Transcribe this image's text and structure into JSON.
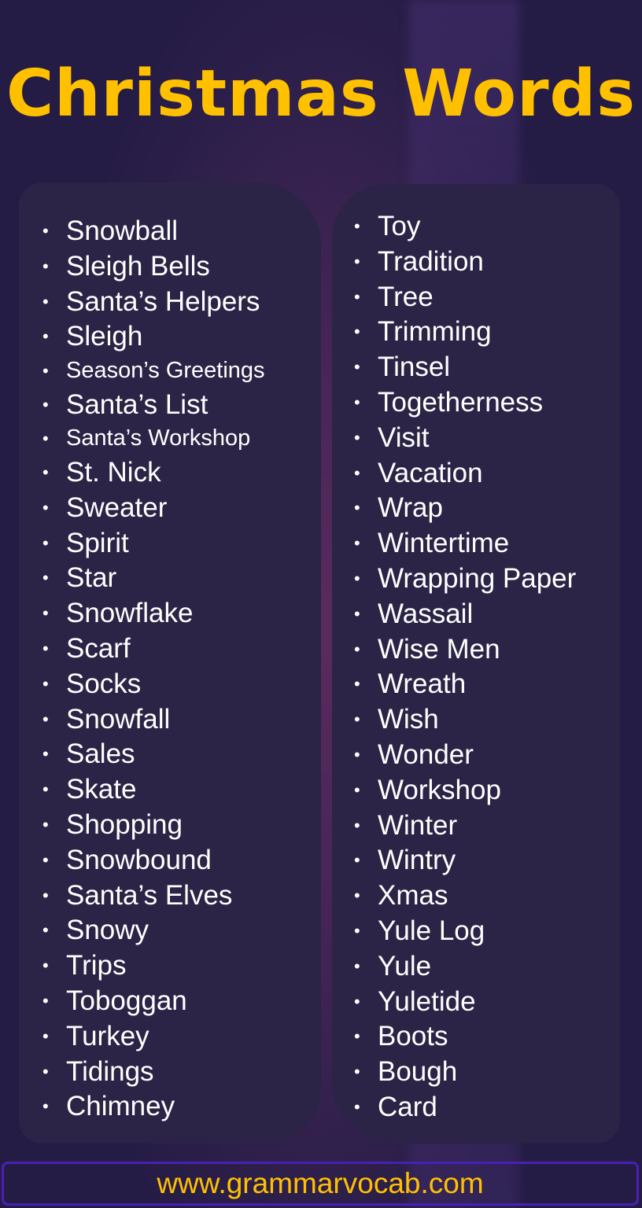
{
  "title": "Christmas Words",
  "bullet": "•",
  "left_column": [
    {
      "text": "Snowball",
      "small": false
    },
    {
      "text": "Sleigh Bells",
      "small": false
    },
    {
      "text": "Santa’s Helpers",
      "small": false
    },
    {
      "text": "Sleigh",
      "small": false
    },
    {
      "text": "Season’s Greetings",
      "small": true
    },
    {
      "text": "Santa’s List",
      "small": false
    },
    {
      "text": "Santa’s Workshop",
      "small": true
    },
    {
      "text": "St. Nick",
      "small": false
    },
    {
      "text": "Sweater",
      "small": false
    },
    {
      "text": "Spirit",
      "small": false
    },
    {
      "text": "Star",
      "small": false
    },
    {
      "text": "Snowflake",
      "small": false
    },
    {
      "text": "Scarf",
      "small": false
    },
    {
      "text": "Socks",
      "small": false
    },
    {
      "text": "Snowfall",
      "small": false
    },
    {
      "text": "Sales",
      "small": false
    },
    {
      "text": "Skate",
      "small": false
    },
    {
      "text": "Shopping",
      "small": false
    },
    {
      "text": "Snowbound",
      "small": false
    },
    {
      "text": "Santa’s Elves",
      "small": false
    },
    {
      "text": "Snowy",
      "small": false
    },
    {
      "text": "Trips",
      "small": false
    },
    {
      "text": "Toboggan",
      "small": false
    },
    {
      "text": "Turkey",
      "small": false
    },
    {
      "text": "Tidings",
      "small": false
    },
    {
      "text": "Chimney",
      "small": false
    }
  ],
  "right_column": [
    "Toy",
    "Tradition",
    "Tree",
    "Trimming",
    "Tinsel",
    "Togetherness",
    "Visit",
    "Vacation",
    "Wrap",
    "Wintertime",
    "Wrapping Paper",
    "Wassail",
    "Wise Men",
    "Wreath",
    "Wish",
    "Wonder",
    "Workshop",
    "Winter",
    "Wintry",
    "Xmas",
    "Yule Log",
    "Yule",
    "Yuletide",
    "Boots",
    "Bough",
    "Card"
  ],
  "footer": {
    "url": "www.grammarvocab.com"
  },
  "colors": {
    "accent": "#ffc000",
    "panel": "#2b2446",
    "footer_border": "#4a1fb8"
  }
}
